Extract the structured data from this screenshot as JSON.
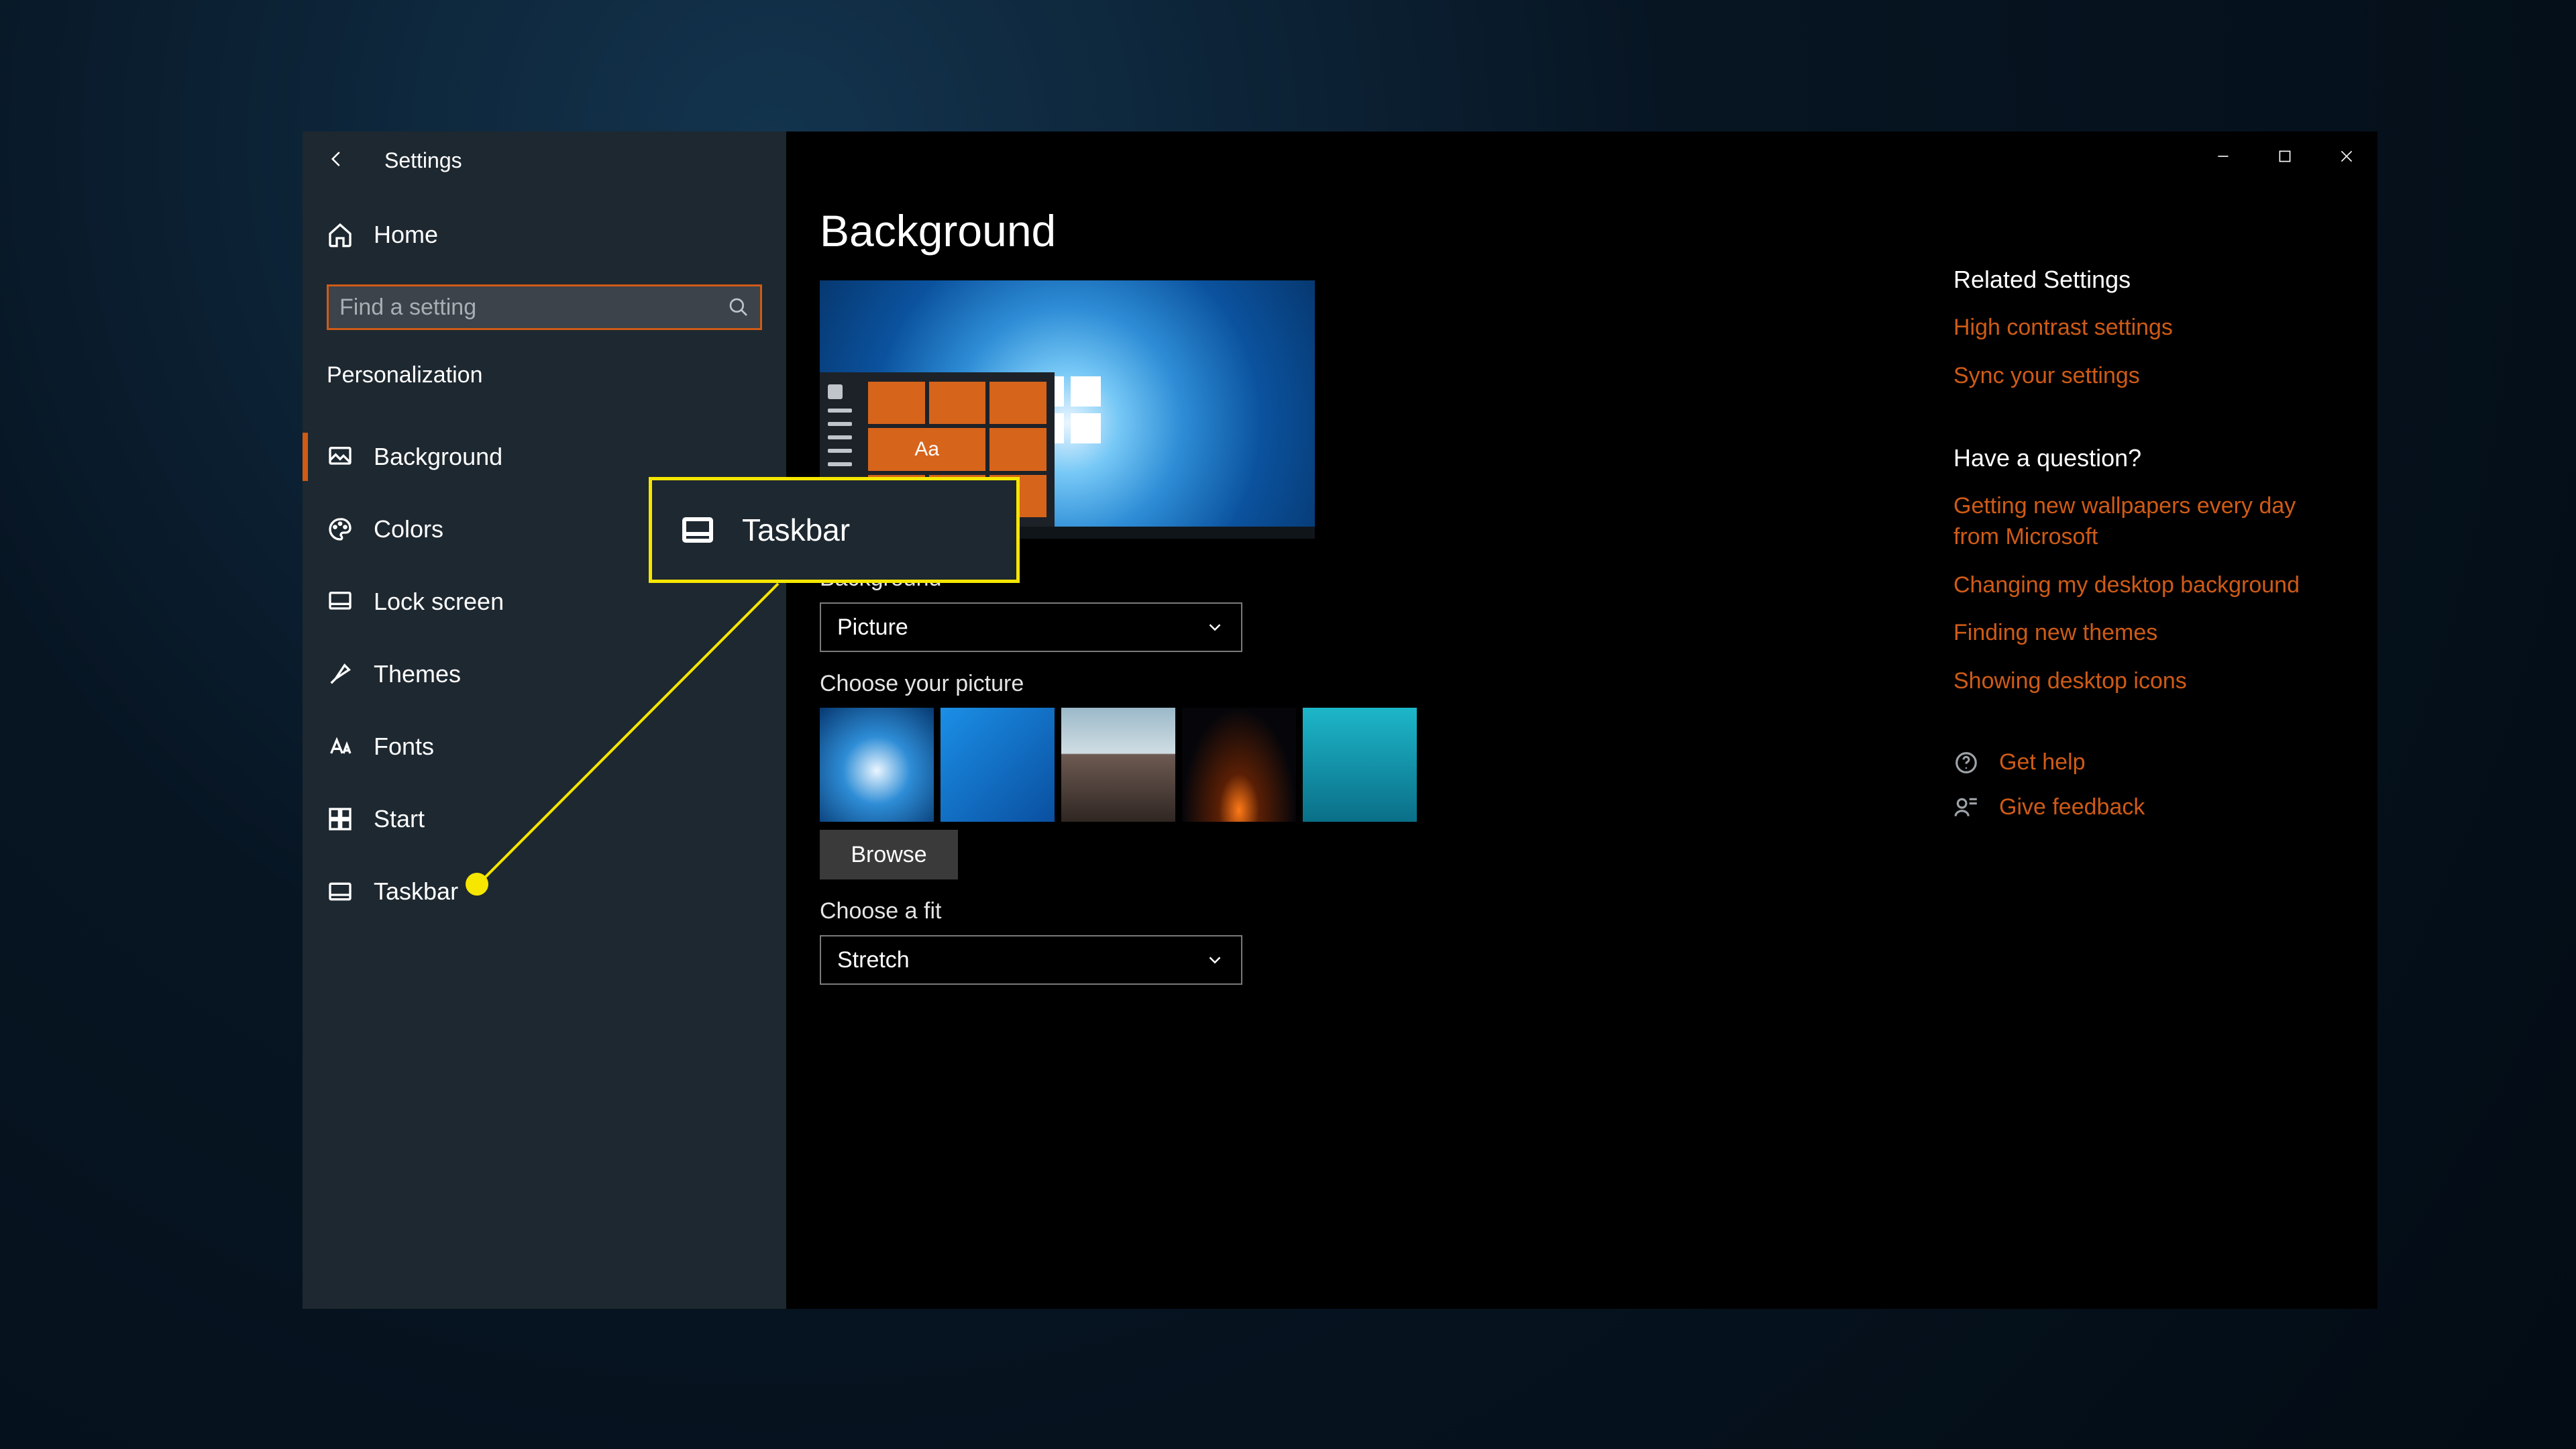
{
  "app_title": "Settings",
  "home_label": "Home",
  "search_placeholder": "Find a setting",
  "section_title": "Personalization",
  "nav": {
    "background": "Background",
    "colors": "Colors",
    "lockscreen": "Lock screen",
    "themes": "Themes",
    "fonts": "Fonts",
    "start": "Start",
    "taskbar": "Taskbar"
  },
  "page_title": "Background",
  "preview_sample_text": "Aa",
  "bg_label": "Background",
  "bg_value": "Picture",
  "choose_pic_label": "Choose your picture",
  "browse_label": "Browse",
  "fit_label": "Choose a fit",
  "fit_value": "Stretch",
  "right": {
    "related_title": "Related Settings",
    "high_contrast": "High contrast settings",
    "sync": "Sync your settings",
    "question_title": "Have a question?",
    "q1": "Getting new wallpapers every day from Microsoft",
    "q2": "Changing my desktop background",
    "q3": "Finding new themes",
    "q4": "Showing desktop icons",
    "get_help": "Get help",
    "give_feedback": "Give feedback"
  },
  "callout_label": "Taskbar"
}
